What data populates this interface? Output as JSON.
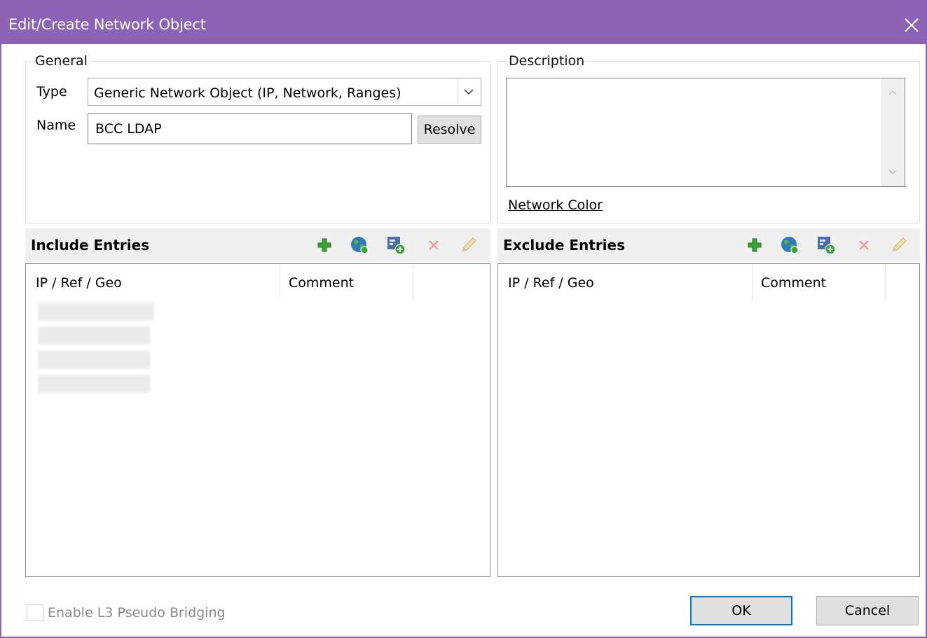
{
  "window": {
    "title": "Edit/Create Network Object",
    "close_icon": "close-icon"
  },
  "general": {
    "legend": "General",
    "type_label": "Type",
    "type_value": "Generic Network Object (IP, Network, Ranges)",
    "name_label": "Name",
    "name_value": "BCC LDAP",
    "resolve_label": "Resolve"
  },
  "description": {
    "legend": "Description",
    "value": "",
    "network_color_link": "Network Color"
  },
  "include": {
    "title": "Include Entries",
    "columns": [
      "IP / Ref / Geo",
      "Comment"
    ],
    "redacted_rows": 4
  },
  "exclude": {
    "title": "Exclude Entries",
    "columns": [
      "IP / Ref / Geo",
      "Comment"
    ]
  },
  "toolbar_icons": [
    "add-icon",
    "globe-icon",
    "add-reference-icon",
    "delete-icon",
    "edit-icon"
  ],
  "footer": {
    "l3_bridging_label": "Enable L3 Pseudo Bridging",
    "l3_bridging_checked": false,
    "ok_label": "OK",
    "cancel_label": "Cancel"
  },
  "colors": {
    "title_bar": "#8b62b6",
    "accent": "#0078d7",
    "section_header": "#f0f0f0"
  }
}
